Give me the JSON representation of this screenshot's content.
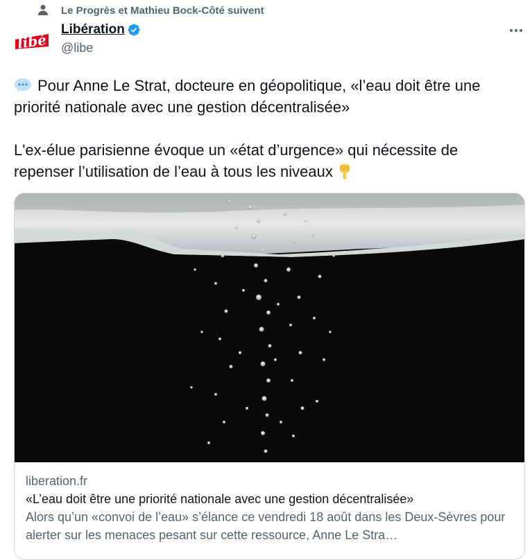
{
  "social_context": {
    "icon": "person-icon",
    "text": "Le Progrès et Mathieu Bock-Côté suivent"
  },
  "author": {
    "name": "Libération",
    "handle": "@libe",
    "avatar_text": "libé",
    "verified_icon": "verified-badge-icon",
    "accent_color": "#1d9bf0"
  },
  "more_icon": "more-horizontal-icon",
  "tweet": {
    "paragraph1_emoji": "speech-bubble-icon",
    "paragraph1": "Pour Anne Le Strat, docteure en géopolitique, «l’eau doit être une priorité nationale avec une gestion décentralisée»",
    "paragraph2": "L'ex-élue parisienne évoque un «état d’urgence» qui nécessite de repenser l’utilisation de l’eau à tous les niveaux",
    "paragraph2_emoji": "pointing-down-icon"
  },
  "card": {
    "domain": "liberation.fr",
    "title": "«L’eau doit être une priorité nationale avec une gestion décentralisée»",
    "description": "Alors qu’un «convoi de l’eau» s’élance ce vendredi 18 août dans les Deux-Sèvres pour alerter sur les menaces pesant sur cette ressource, Anne Le Stra…"
  },
  "colors": {
    "text_primary": "#0f1419",
    "text_secondary": "#536471",
    "brand_red": "#e3001b",
    "border": "#cfd9de"
  }
}
